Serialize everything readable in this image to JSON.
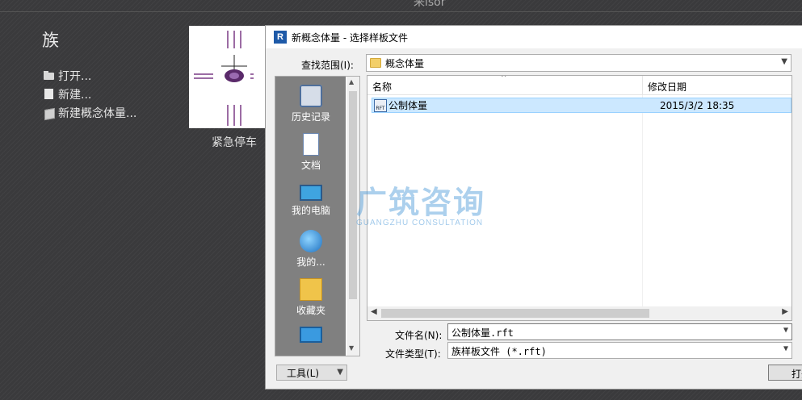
{
  "background_window": {
    "title_partial": "来isor",
    "family_heading": "族",
    "links": [
      {
        "icon": "open-folder-icon",
        "label": "打开..."
      },
      {
        "icon": "document-icon",
        "label": "新建..."
      },
      {
        "icon": "cube-icon",
        "label": "新建概念体量..."
      }
    ],
    "thumbnail_caption": "紧急停车"
  },
  "dialog": {
    "app_icon": "R",
    "title": "新概念体量 - 选择样板文件",
    "look_in": {
      "label": "查找范围(I):",
      "value": "概念体量"
    },
    "places": [
      {
        "icon": "history-icon",
        "label": "历史记录"
      },
      {
        "icon": "documents-icon",
        "label": "文档"
      },
      {
        "icon": "computer-icon",
        "label": "我的电脑"
      },
      {
        "icon": "network-icon",
        "label": "我的..."
      },
      {
        "icon": "favorites-icon",
        "label": "收藏夹"
      },
      {
        "icon": "desktop-icon",
        "label": ""
      }
    ],
    "columns": {
      "name": "名称",
      "date": "修改日期"
    },
    "files": [
      {
        "icon": "rft-file-icon",
        "icon_text": "RFT",
        "name": "公制体量",
        "date": "2015/3/2 18:35",
        "selected": true
      }
    ],
    "file_name": {
      "label": "文件名(N):",
      "value": "公制体量.rft"
    },
    "file_type": {
      "label": "文件类型(T):",
      "value": "族样板文件 (*.rft)"
    },
    "tools_button": "工具(L)",
    "open_button": "打开"
  },
  "watermark": {
    "cn": "广筑咨询",
    "en": "GUANGZHU CONSULTATION"
  },
  "colors": {
    "selection": "#cce8ff",
    "dark_bg": "#3a3a3c",
    "places_bg": "#808080"
  }
}
